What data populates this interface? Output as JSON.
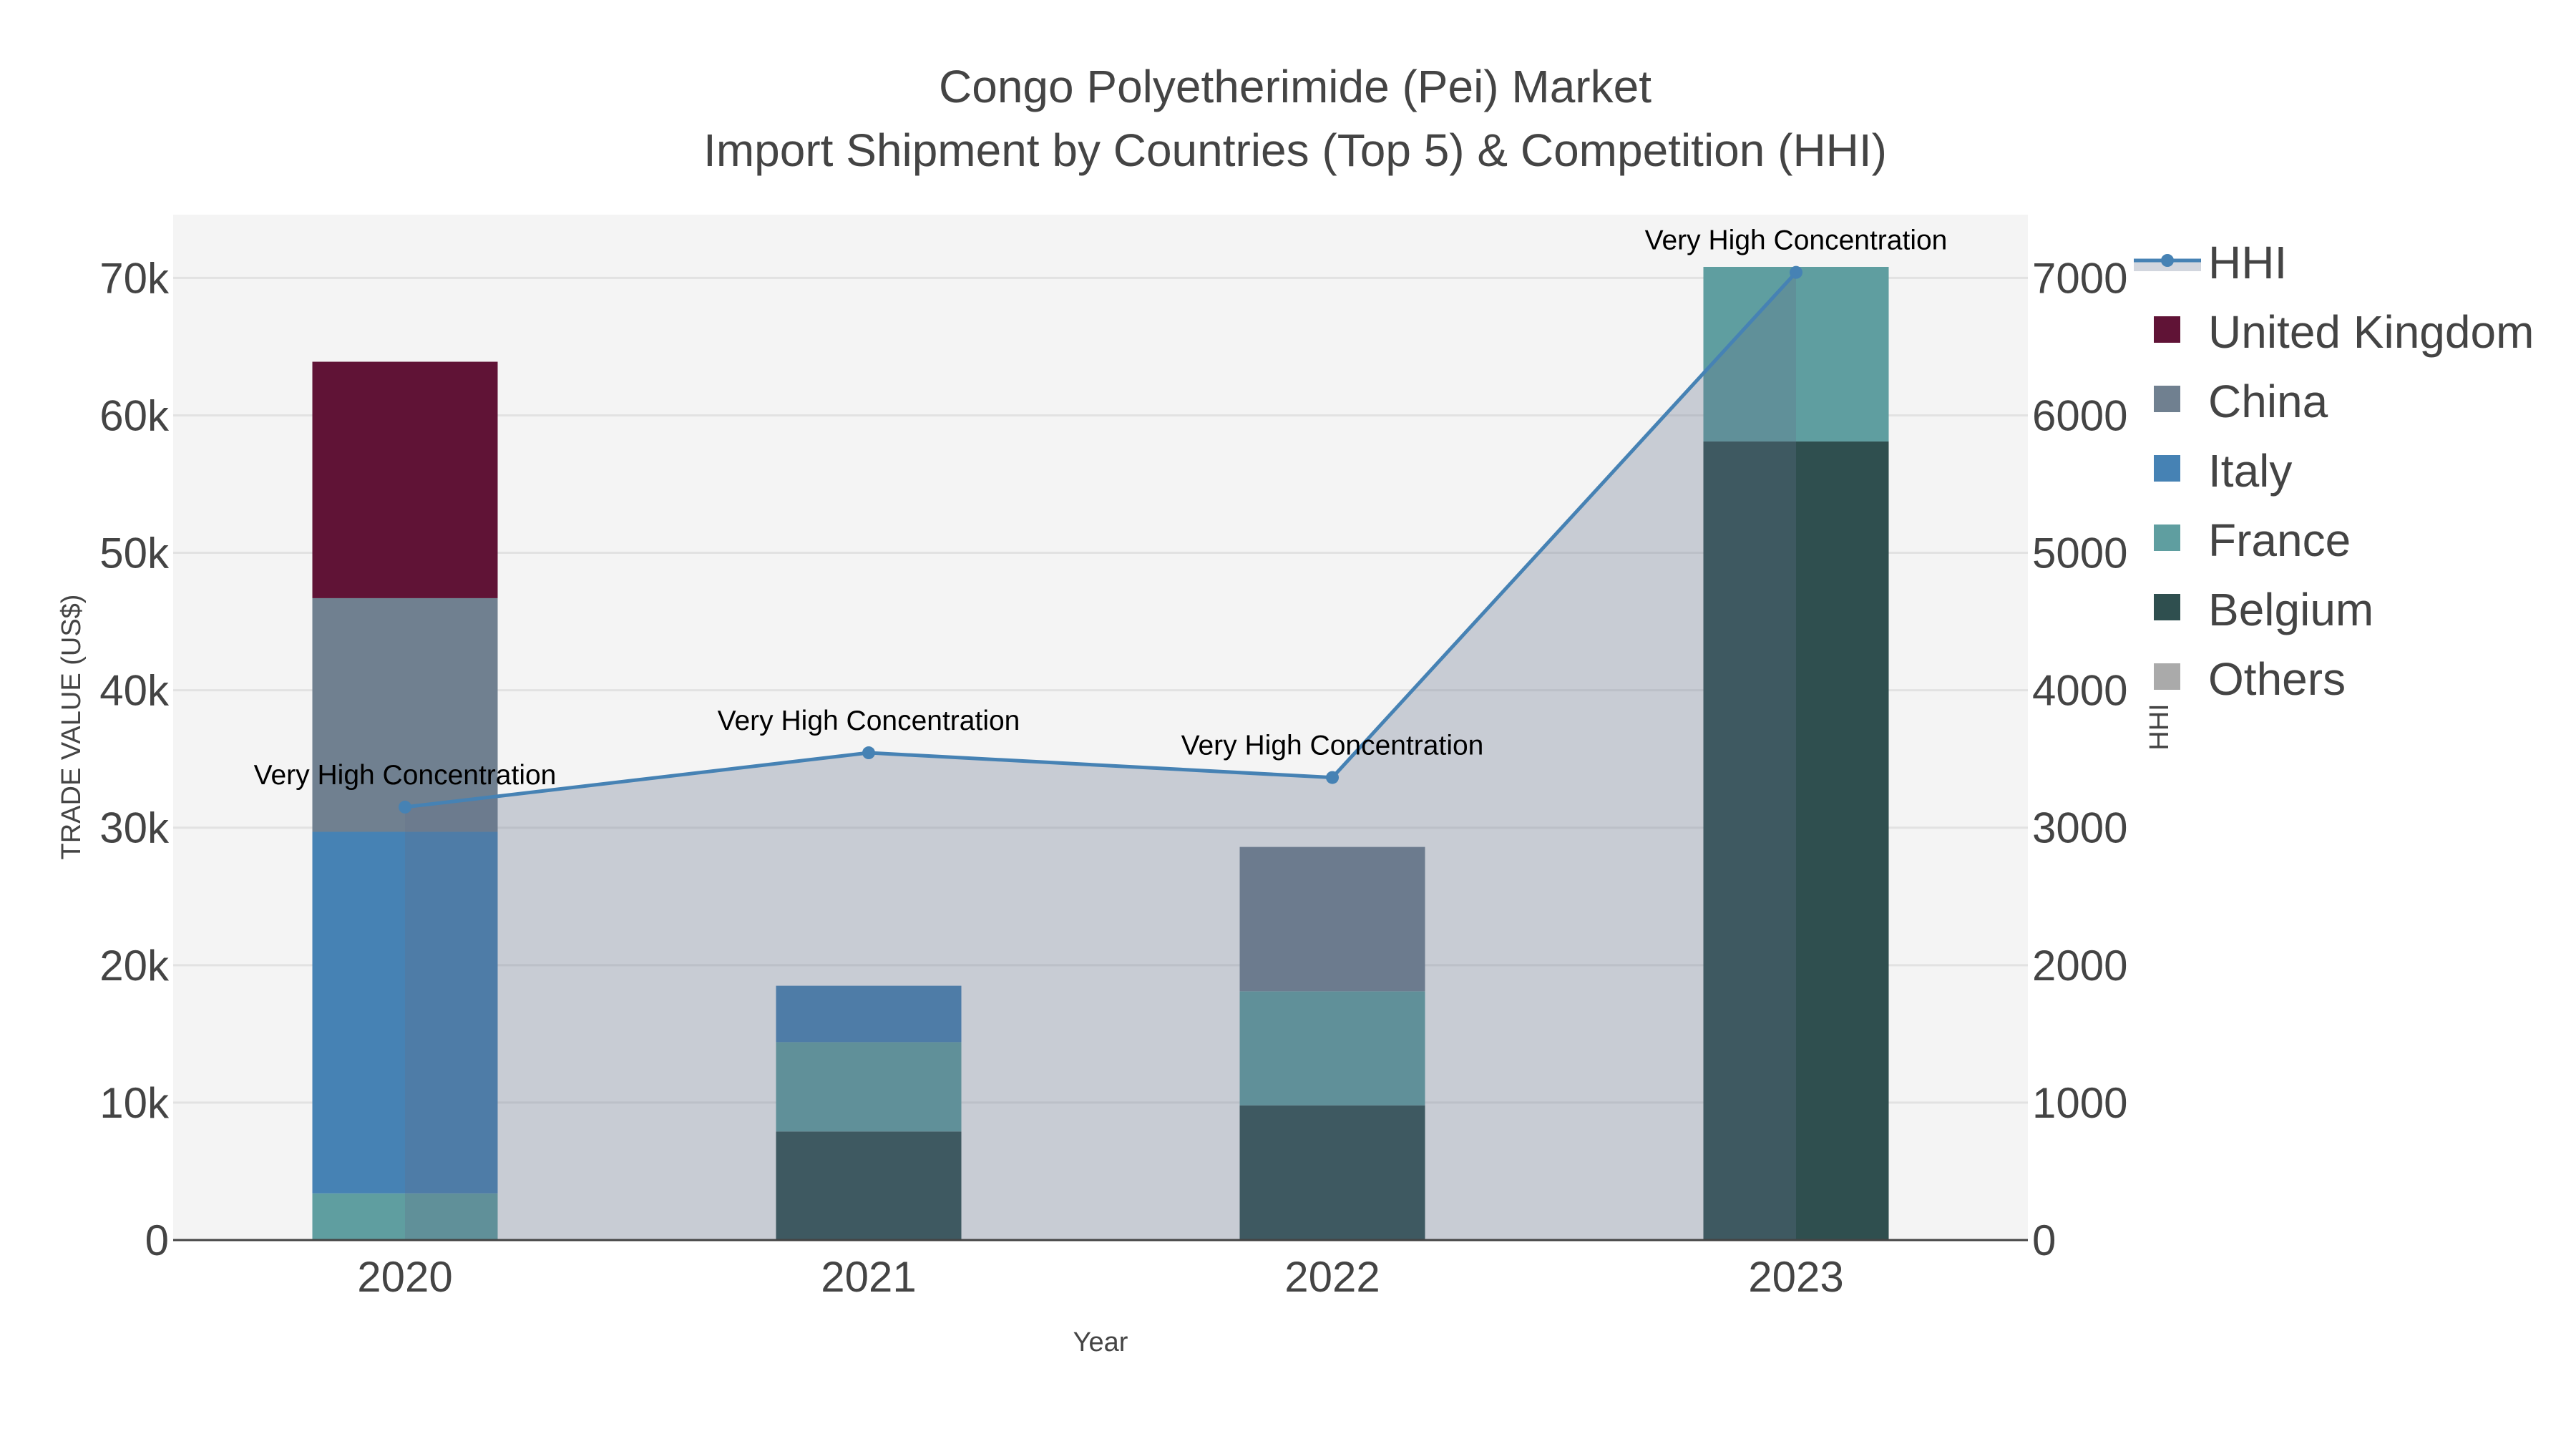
{
  "chart_data": {
    "type": "bar",
    "stacked": true,
    "title_line1": "Congo Polyetherimide (Pei) Market",
    "title_line2": "Import Shipment by Countries (Top 5) & Competition (HHI)",
    "xlabel": "Year",
    "ylabel": "TRADE VALUE (US$)",
    "y2label": "HHI",
    "categories": [
      "2020",
      "2021",
      "2022",
      "2023"
    ],
    "ylim": [
      0,
      74600
    ],
    "y2lim": [
      0,
      7460
    ],
    "yticks": [
      0,
      10000,
      20000,
      30000,
      40000,
      50000,
      60000,
      70000
    ],
    "ytick_labels": [
      "0",
      "10k",
      "20k",
      "30k",
      "40k",
      "50k",
      "60k",
      "70k"
    ],
    "y2ticks": [
      0,
      1000,
      2000,
      3000,
      4000,
      5000,
      6000,
      7000
    ],
    "y2tick_labels": [
      "0",
      "1000",
      "2000",
      "3000",
      "4000",
      "5000",
      "6000",
      "7000"
    ],
    "grid": true,
    "legend_position": "right",
    "series": [
      {
        "name": "Belgium",
        "color": "#2f4f4f",
        "values": [
          0,
          7900,
          9800,
          58100
        ]
      },
      {
        "name": "France",
        "color": "#5f9ea0",
        "values": [
          3400,
          6500,
          8300,
          12700
        ]
      },
      {
        "name": "Italy",
        "color": "#4682b4",
        "values": [
          26300,
          4100,
          0,
          0
        ]
      },
      {
        "name": "China",
        "color": "#708090",
        "values": [
          17000,
          0,
          10500,
          0
        ]
      },
      {
        "name": "United Kingdom",
        "color": "#601336",
        "values": [
          17200,
          0,
          0,
          0
        ]
      },
      {
        "name": "Others",
        "color": "#aaaaaa",
        "values": [
          0,
          0,
          0,
          0
        ]
      }
    ],
    "line_series": {
      "name": "HHI",
      "color": "#4682b4",
      "fill": "rgba(100,112,138,0.3)",
      "values": [
        3150,
        3545,
        3365,
        7040
      ],
      "annotations": [
        "Very High Concentration",
        "Very High Concentration",
        "Very High Concentration",
        "Very High Concentration"
      ]
    },
    "legend_order": [
      "HHI",
      "United Kingdom",
      "China",
      "Italy",
      "France",
      "Belgium",
      "Others"
    ]
  }
}
